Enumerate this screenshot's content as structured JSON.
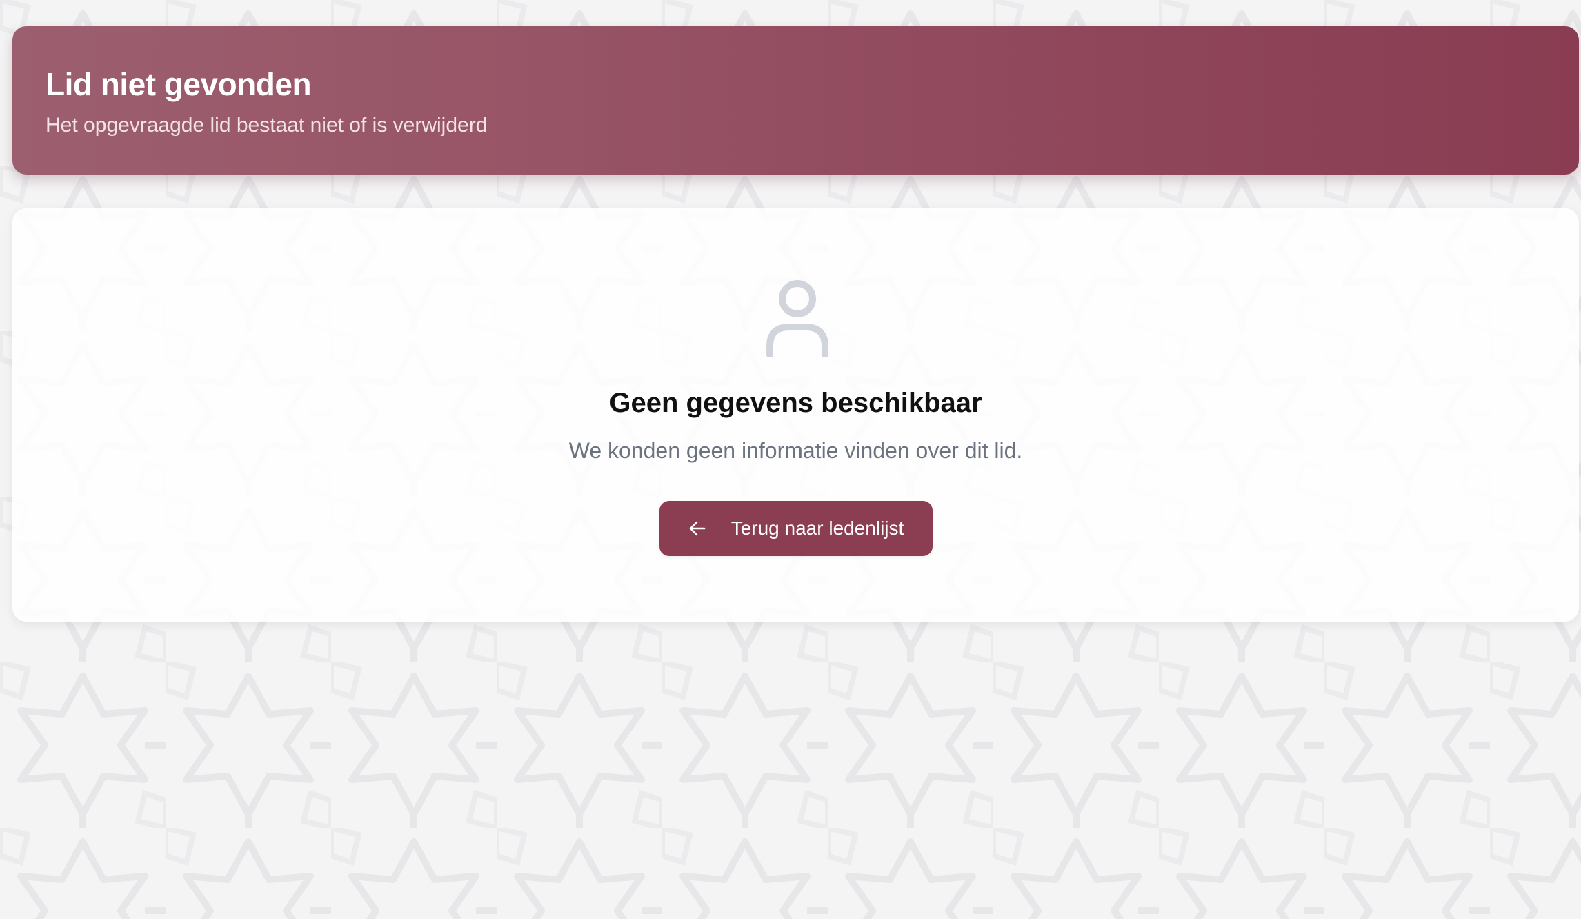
{
  "header": {
    "title": "Lid niet gevonden",
    "subtitle": "Het opgevraagde lid bestaat niet of is verwijderd"
  },
  "empty_state": {
    "icon": "user-icon",
    "title": "Geen gegevens beschikbaar",
    "message": "We konden geen informatie vinden over dit lid."
  },
  "back_button": {
    "icon": "arrow-left-icon",
    "label": "Terug naar ledenlijst"
  },
  "colors": {
    "brand": "#8b3d52",
    "header_gradient_start": "#9c5f6f",
    "header_gradient_end": "#8a3d52",
    "icon_muted": "#d1d5db",
    "text_muted": "#6b7280",
    "page_background": "#f4f4f5"
  }
}
